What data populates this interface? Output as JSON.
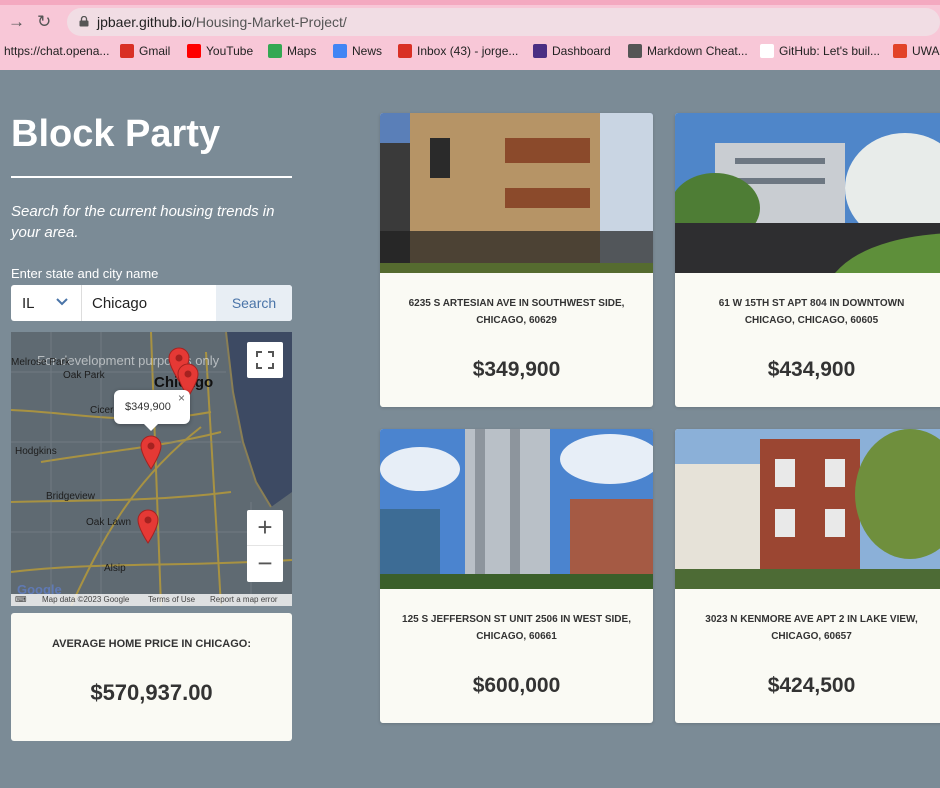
{
  "browser": {
    "url_host": "jpbaer.github.io",
    "url_path": "/Housing-Market-Project/",
    "bookmarks": [
      {
        "label": "https://chat.opena...",
        "color": "#ffffff"
      },
      {
        "label": "Gmail",
        "color": "#d93025"
      },
      {
        "label": "YouTube",
        "color": "#ff0000"
      },
      {
        "label": "Maps",
        "color": "#34a853"
      },
      {
        "label": "News",
        "color": "#4285f4"
      },
      {
        "label": "Inbox (43) - jorge...",
        "color": "#d93025"
      },
      {
        "label": "Dashboard",
        "color": "#4b2e83"
      },
      {
        "label": "Markdown Cheat...",
        "color": "#555555"
      },
      {
        "label": "GitHub: Let's buil...",
        "color": "#ffffff"
      },
      {
        "label": "UWA",
        "color": "#e24329"
      }
    ]
  },
  "page": {
    "title": "Block Party",
    "tagline": "Search for the current housing trends in your area.",
    "form_label": "Enter state and city name",
    "state_value": "IL",
    "city_value": "Chicago",
    "search_label": "Search"
  },
  "map": {
    "dev_watermark": "For development purposes only",
    "city_label": "Chicago",
    "towns": [
      "Melrose Park",
      "Oak Park",
      "Cicero",
      "Hodgkins",
      "Bridgeview",
      "Oak Lawn",
      "Alsip"
    ],
    "popup_value": "$349,900",
    "popup_close": "×",
    "attribution": [
      "Map data ©2023 Google",
      "Terms of Use",
      "Report a map error"
    ],
    "google_logo": "Google",
    "zoom_in": "+",
    "zoom_out": "−"
  },
  "average": {
    "caption": "AVERAGE HOME PRICE IN CHICAGO:",
    "value": "$570,937.00"
  },
  "listings": [
    {
      "address": "6235 S ARTESIAN AVE IN SOUTHWEST SIDE, CHICAGO, 60629",
      "price": "$349,900"
    },
    {
      "address": "61 W 15TH ST APT 804 IN DOWNTOWN CHICAGO, CHICAGO, 60605",
      "price": "$434,900"
    },
    {
      "address": "125 S JEFFERSON ST UNIT 2506 IN WEST SIDE, CHICAGO, 60661",
      "price": "$600,000"
    },
    {
      "address": "3023 N KENMORE AVE APT 2 IN LAKE VIEW, CHICAGO, 60657",
      "price": "$424,500"
    }
  ],
  "colors": {
    "background": "#7b8b96",
    "card": "#fafaf4",
    "accent": "#4a74a8",
    "pin": "#e53935"
  }
}
